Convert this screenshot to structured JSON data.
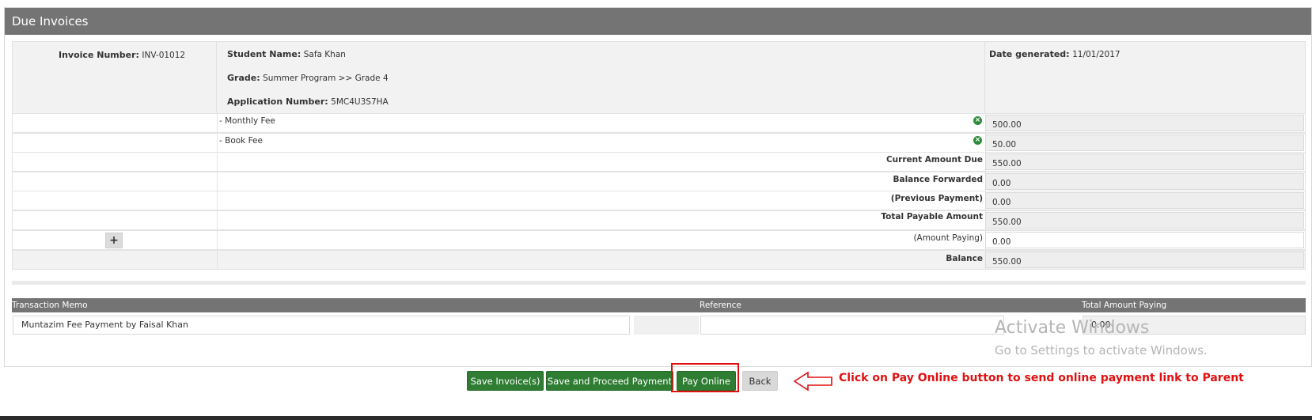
{
  "panel": {
    "title": "Due Invoices"
  },
  "invoice": {
    "invoice_number_label": "Invoice Number:",
    "invoice_number": "INV-01012",
    "student_name_label": "Student Name:",
    "student_name": "Safa Khan",
    "grade_label": "Grade:",
    "grade": "Summer Program >> Grade 4",
    "application_number_label": "Application Number:",
    "application_number": "5MC4U3S7HA",
    "date_generated_label": "Date generated:",
    "date_generated": "11/01/2017"
  },
  "fees": [
    {
      "name": "- Monthly Fee",
      "amount": "500.00"
    },
    {
      "name": "- Book Fee",
      "amount": "50.00"
    }
  ],
  "summary": {
    "current_amount_due_label": "Current Amount Due",
    "current_amount_due": "550.00",
    "balance_forwarded_label": "Balance Forwarded",
    "balance_forwarded": "0.00",
    "previous_payment_label": "(Previous Payment)",
    "previous_payment": "0.00",
    "total_payable_label": "Total Payable Amount",
    "total_payable": "550.00",
    "amount_paying_label": "(Amount Paying)",
    "amount_paying": "0.00",
    "balance_label": "Balance",
    "balance": "550.00",
    "add_symbol": "+"
  },
  "transaction": {
    "memo_header": "Transaction Memo",
    "reference_header": "Reference",
    "total_header": "Total Amount Paying",
    "memo_value": "Muntazim Fee Payment by Faisal Khan",
    "reference_value": "",
    "total_value": "0.00"
  },
  "watermark": {
    "line1": "Activate Windows",
    "line2": "Go to Settings to activate Windows."
  },
  "buttons": {
    "save_invoices": "Save Invoice(s)",
    "save_proceed": "Save and Proceed Payment",
    "pay_online": "Pay Online",
    "back": "Back"
  },
  "annotation": "Click on Pay Online button to send online payment link to Parent",
  "colors": {
    "header": "#747474",
    "primary_button": "#2e7d32",
    "annotation": "#e01010"
  }
}
